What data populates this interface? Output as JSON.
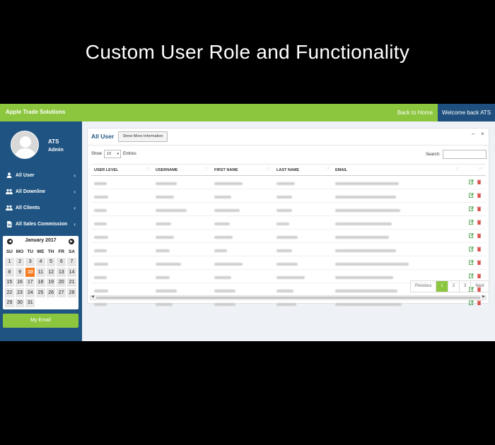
{
  "banner": {
    "title": "Custom User Role and Functionality"
  },
  "topbar": {
    "brand": "Apple Trade Solutions",
    "back_home": "Back to Home",
    "welcome": "Welcome back ATS"
  },
  "profile": {
    "name": "ATS",
    "role": "Admin"
  },
  "menu": [
    {
      "label": "All User",
      "icon": "user-icon"
    },
    {
      "label": "All Downline",
      "icon": "users-icon"
    },
    {
      "label": "All Clients",
      "icon": "users-icon"
    },
    {
      "label": "All Sales Commission",
      "icon": "document-icon"
    }
  ],
  "calendar": {
    "title": "January 2017",
    "days_of_week": [
      "SU",
      "MO",
      "TU",
      "WE",
      "TH",
      "FR",
      "SA"
    ],
    "weeks": [
      [
        "1",
        "2",
        "3",
        "4",
        "5",
        "6",
        "7"
      ],
      [
        "8",
        "9",
        "10",
        "11",
        "12",
        "13",
        "14"
      ],
      [
        "15",
        "16",
        "17",
        "18",
        "19",
        "20",
        "21"
      ],
      [
        "22",
        "23",
        "24",
        "25",
        "26",
        "27",
        "28"
      ],
      [
        "29",
        "30",
        "31",
        "",
        "",
        "",
        ""
      ]
    ],
    "today": "10",
    "today_color": "#f47b20"
  },
  "email_button": "My Email",
  "panel": {
    "title": "All User",
    "more_button": "Show More Information",
    "show_label": "Show",
    "entries_value": "10",
    "entries_label": "Entries",
    "search_label": "Search:",
    "columns": [
      "USER LEVEL",
      "USERNAME",
      "FIRST NAME",
      "LAST NAME",
      "EMAIL",
      ""
    ],
    "row_count": 10,
    "pagination": [
      "Previous",
      "1",
      "2",
      "3",
      "Next"
    ],
    "active_page": "1"
  },
  "colors": {
    "accent_green": "#8cc63f",
    "sidebar_blue": "#1f5482",
    "header_blue": "#1e4f7e",
    "delete_red": "#d9534f",
    "edit_green": "#3a9a3a"
  }
}
